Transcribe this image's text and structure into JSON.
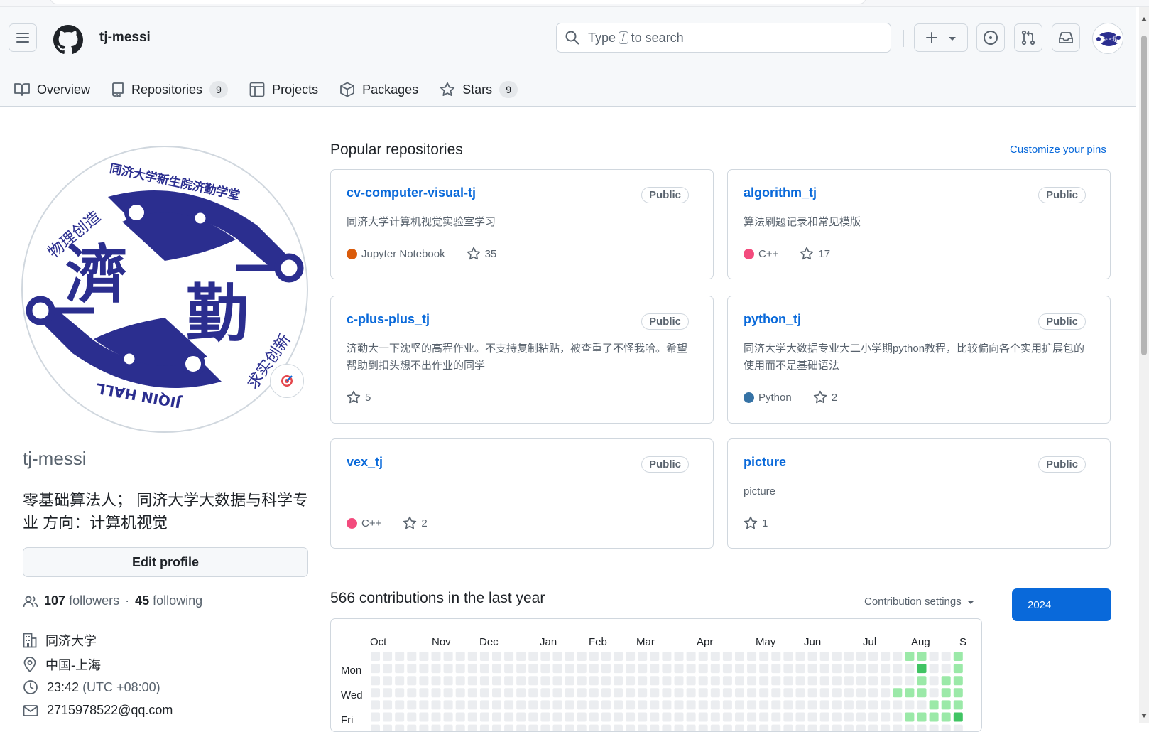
{
  "header": {
    "username": "tj-messi",
    "search_prefix": "Type",
    "search_key": "/",
    "search_suffix": "to search"
  },
  "tabs": [
    {
      "label": "Overview",
      "icon": "book-icon"
    },
    {
      "label": "Repositories",
      "icon": "repo-icon",
      "count": "9"
    },
    {
      "label": "Projects",
      "icon": "table-icon"
    },
    {
      "label": "Packages",
      "icon": "package-icon"
    },
    {
      "label": "Stars",
      "icon": "star-icon",
      "count": "9"
    }
  ],
  "profile": {
    "login": "tj-messi",
    "bio": "零基础算法人； 同济大学大数据与科学专业 方向：计算机视觉",
    "edit_label": "Edit profile",
    "followers_count": "107",
    "followers_label": "followers",
    "separator": "·",
    "following_count": "45",
    "following_label": "following",
    "organization": "同济大学",
    "location": "中国-上海",
    "local_time": "23:42",
    "timezone": "(UTC +08:00)",
    "email": "2715978522@qq.com",
    "avatar_text": {
      "top": "同济大学新生院济勤学堂",
      "big1": "濟",
      "big2": "勤",
      "left": "物理创造",
      "right": "求实创新",
      "bottom": "JIQIN HALL"
    }
  },
  "popular": {
    "title": "Popular repositories",
    "customize_label": "Customize your pins",
    "repos": [
      {
        "name": "cv-computer-visual-tj",
        "visibility": "Public",
        "description": "同济大学计算机视觉实验室学习",
        "language": "Jupyter Notebook",
        "lang_color": "#DA5B0B",
        "stars": "35"
      },
      {
        "name": "algorithm_tj",
        "visibility": "Public",
        "description": "算法刷题记录和常见模版",
        "language": "C++",
        "lang_color": "#f34b7d",
        "stars": "17"
      },
      {
        "name": "c-plus-plus_tj",
        "visibility": "Public",
        "description": "济勤大一下沈坚的高程作业。不支持复制粘贴，被查重了不怪我哈。希望帮助到扣头想不出作业的同学",
        "language": "",
        "lang_color": "",
        "stars": "5"
      },
      {
        "name": "python_tj",
        "visibility": "Public",
        "description": "同济大学大数据专业大二小学期python教程，比较偏向各个实用扩展包的使用而不是基础语法",
        "language": "Python",
        "lang_color": "#3572A5",
        "stars": "2"
      },
      {
        "name": "vex_tj",
        "visibility": "Public",
        "description": "",
        "language": "C++",
        "lang_color": "#f34b7d",
        "stars": "2"
      },
      {
        "name": "picture",
        "visibility": "Public",
        "description": "picture",
        "language": "",
        "lang_color": "",
        "stars": "1"
      }
    ]
  },
  "contributions": {
    "title": "566 contributions in the last year",
    "settings_label": "Contribution settings",
    "year_label": "2024",
    "months": [
      "Oct",
      "Nov",
      "Dec",
      "Jan",
      "Feb",
      "Mar",
      "Apr",
      "May",
      "Jun",
      "Jul",
      "Aug",
      "S"
    ],
    "day_labels": [
      "Mon",
      "Wed",
      "Fri"
    ],
    "colors": {
      "empty": "#ebedf0",
      "l1": "#9be9a8",
      "l2": "#40c463"
    }
  }
}
